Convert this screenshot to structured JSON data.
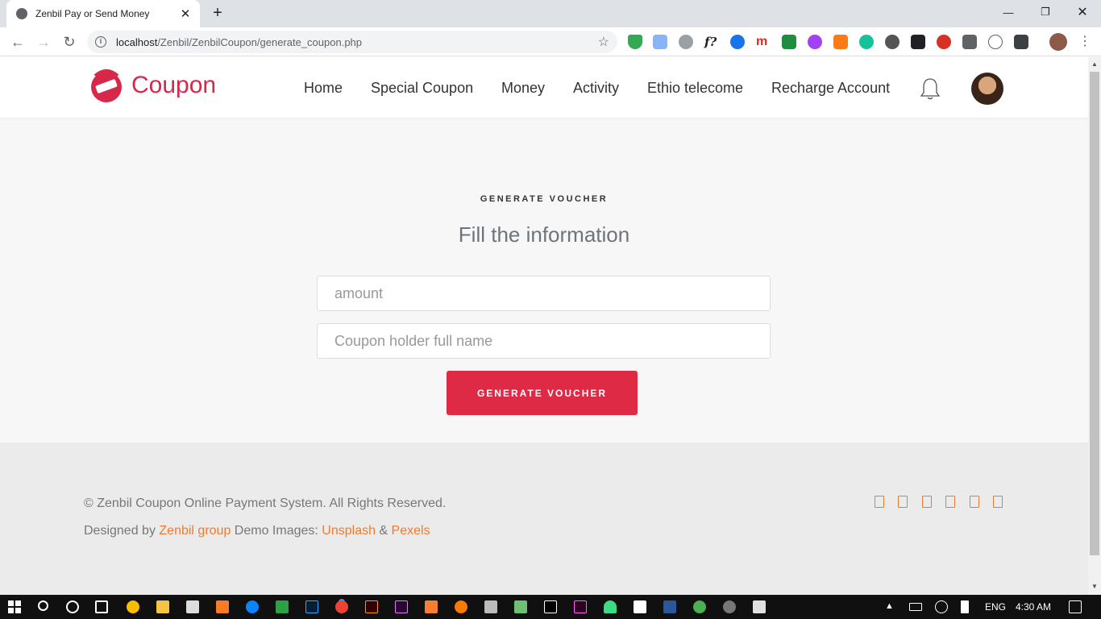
{
  "browser": {
    "tab_title": "Zenbil Pay or Send Money",
    "tab_close": "✕",
    "new_tab": "+",
    "url_host": "localhost",
    "url_path": "/Zenbil/ZenbilCoupon/generate_coupon.php",
    "minimize": "—",
    "restore": "❐",
    "close": "✕"
  },
  "header": {
    "brand": "Coupon",
    "nav": [
      "Home",
      "Special Coupon",
      "Money",
      "Activity",
      "Ethio telecome",
      "Recharge Account"
    ]
  },
  "form": {
    "eyebrow": "GENERATE VOUCHER",
    "heading": "Fill the information",
    "amount_placeholder": "amount",
    "name_placeholder": "Coupon holder full name",
    "submit_label": "GENERATE VOUCHER"
  },
  "footer": {
    "copyright": "© Zenbil Coupon Online Payment System. All Rights Reserved.",
    "designed_by": "Designed by ",
    "designer": "Zenbil group",
    "demo_images": " Demo Images: ",
    "unsplash": "Unsplash",
    "amp": " & ",
    "pexels": "Pexels"
  },
  "taskbar": {
    "lang": "ENG",
    "time": "4:30 AM"
  },
  "colors": {
    "brand": "#d8284a",
    "button": "#df2a46",
    "link": "#f07a2c"
  }
}
